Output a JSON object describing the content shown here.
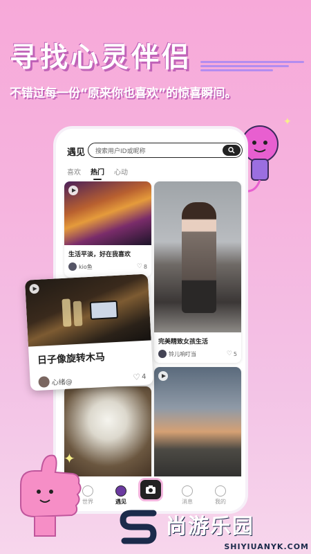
{
  "promo": {
    "headline": "寻找心灵伴侣",
    "subline": "不错过每一份“原来你也喜欢”的惊喜瞬间。"
  },
  "app": {
    "page_title": "遇见",
    "search": {
      "placeholder": "搜索用户ID或昵称",
      "icon": "search-icon"
    },
    "tabs": [
      {
        "label": "喜欢",
        "active": false
      },
      {
        "label": "热门",
        "active": true
      },
      {
        "label": "心动",
        "active": false
      }
    ],
    "feed": [
      {
        "title": "生活平淡，好在我喜欢",
        "author": "kio鱼",
        "likes": "8"
      },
      {
        "title": "完美精致女孩生活",
        "author": "铃儿响叮当",
        "likes": "5"
      },
      {
        "title": "",
        "author": "",
        "likes": ""
      },
      {
        "title": "",
        "author": "",
        "likes": ""
      }
    ],
    "featured": {
      "title": "日子像旋转木马",
      "author": "心绪@",
      "likes": "4"
    },
    "nav": [
      {
        "label": "世界",
        "icon": "planet-icon"
      },
      {
        "label": "遇见",
        "icon": "meet-icon",
        "active": true
      },
      {
        "label": "",
        "icon": "camera-icon"
      },
      {
        "label": "消息",
        "icon": "message-icon"
      },
      {
        "label": "我的",
        "icon": "profile-icon"
      }
    ]
  },
  "watermark": {
    "name": "尚游乐园",
    "url": "SHIYIUANYK.COM"
  },
  "colors": {
    "background": "#f7a9d9",
    "accent": "#c063b8",
    "nav_active": "#6b3aa0"
  }
}
